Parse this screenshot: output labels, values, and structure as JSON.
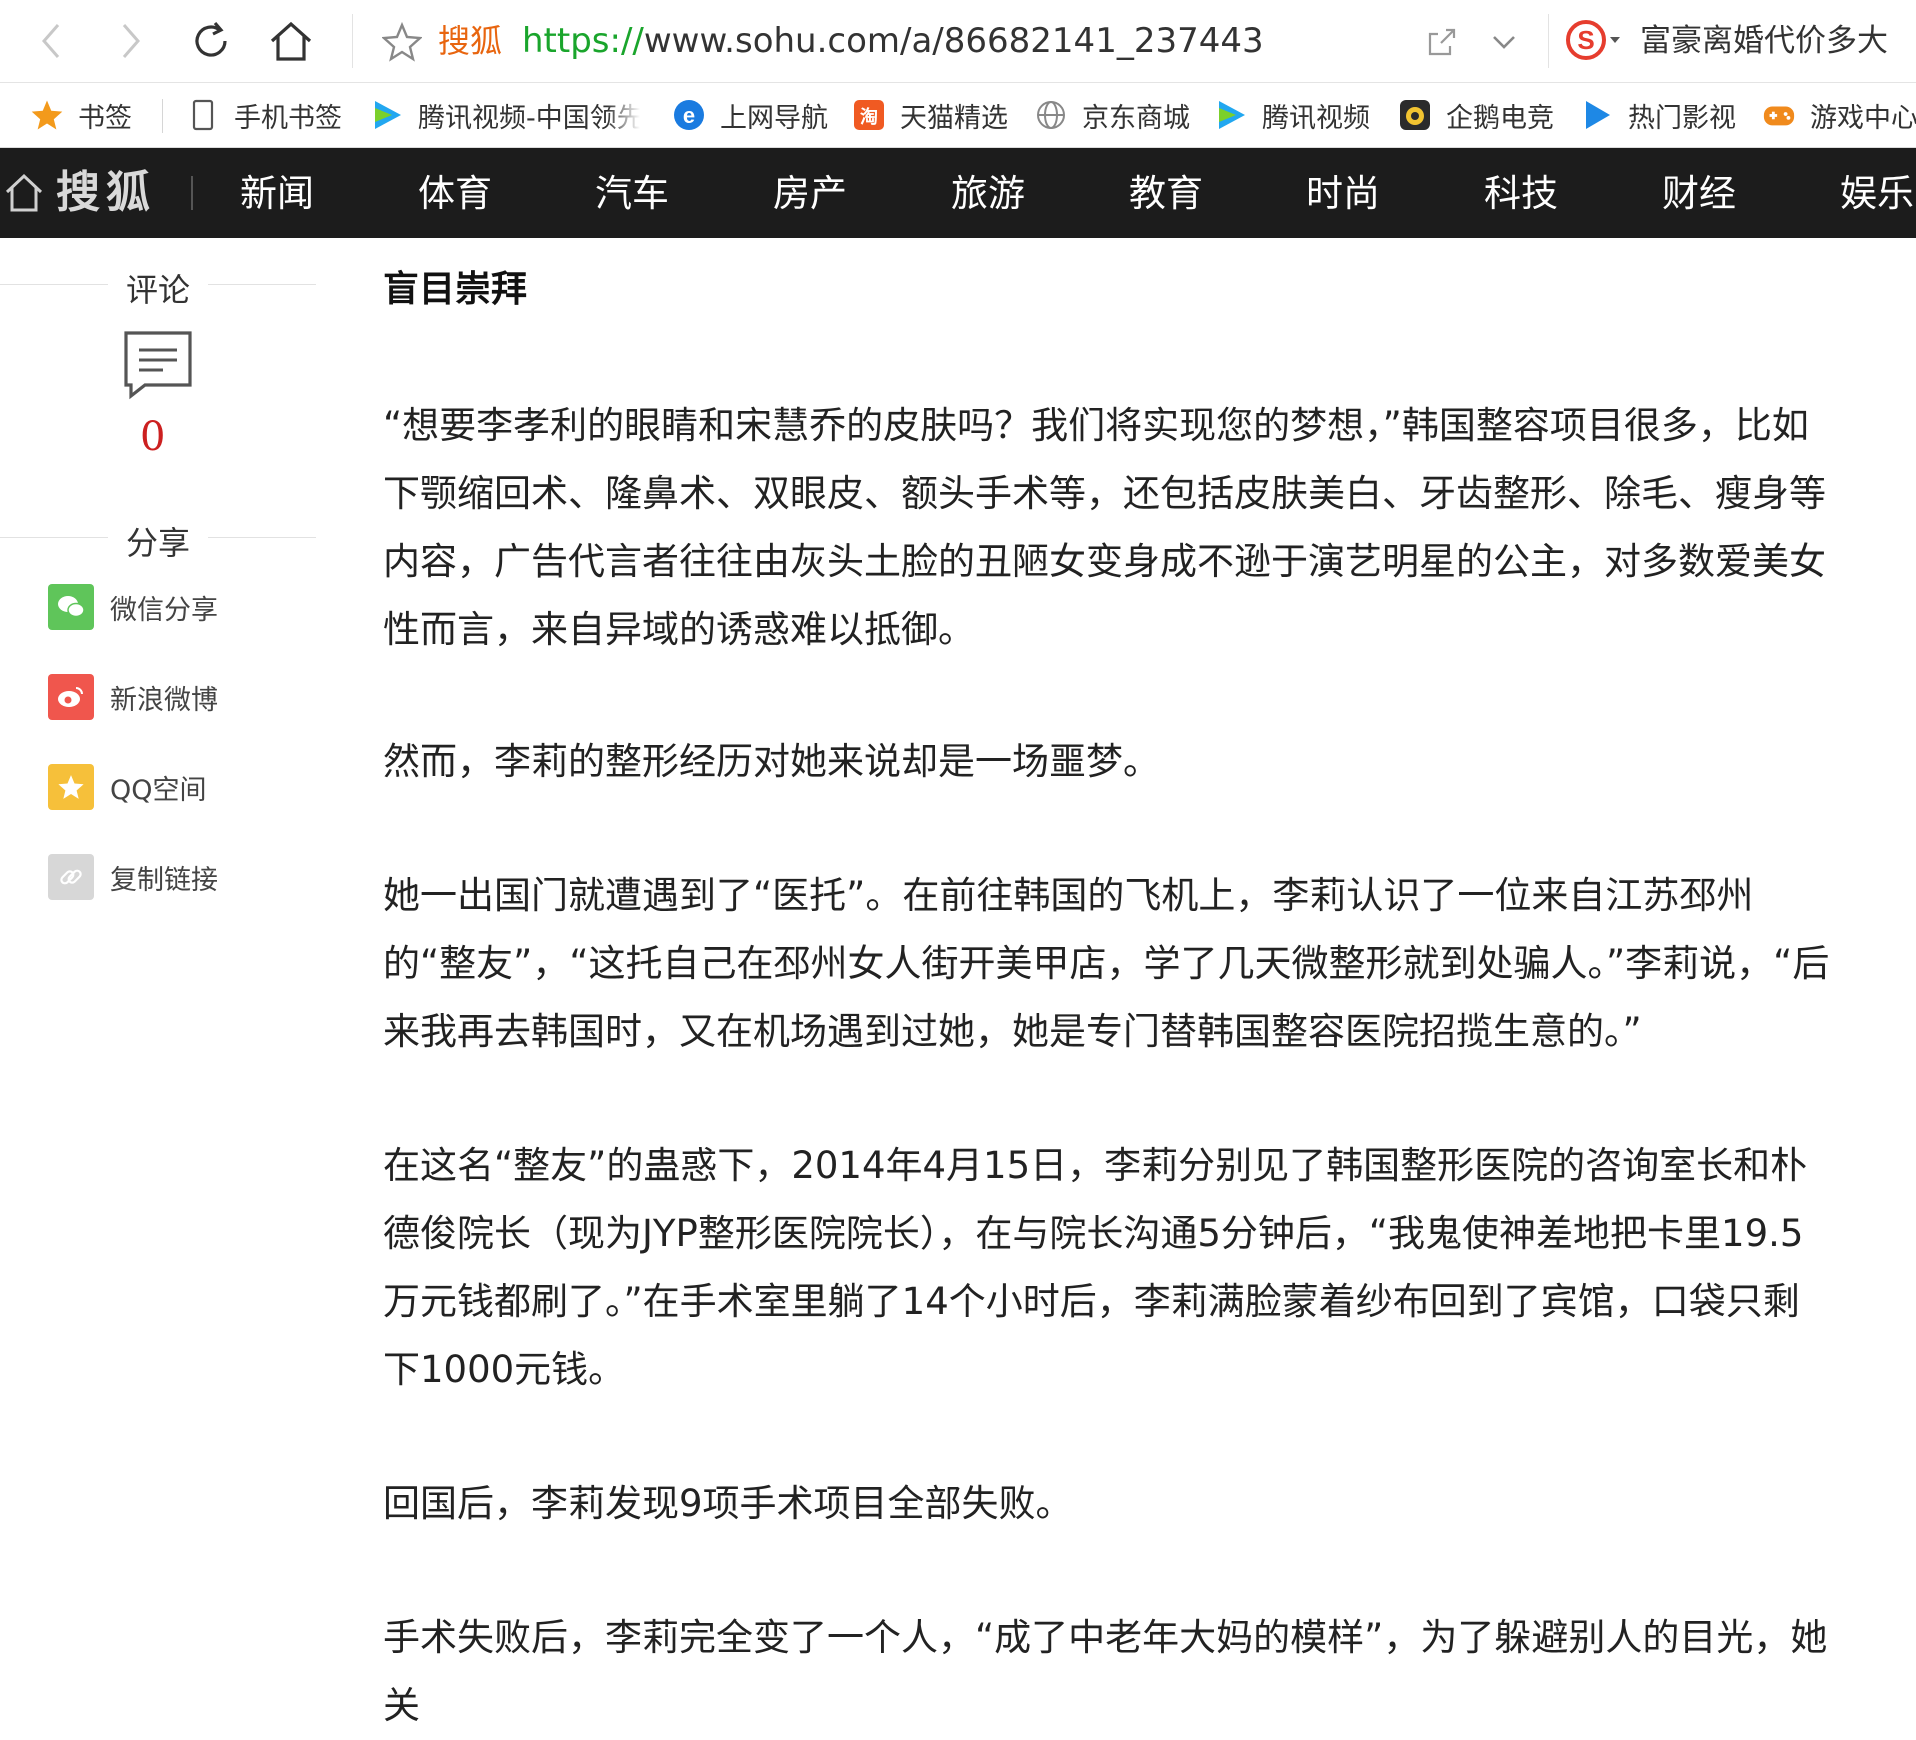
{
  "browser": {
    "address": {
      "site_name": "搜狐",
      "url_scheme": "https://",
      "url_rest": "www.sohu.com/a/86682141_237443"
    },
    "search_box_text": "富豪离婚代价多大",
    "icons": [
      "back-icon",
      "forward-icon",
      "reload-icon",
      "home-icon",
      "star-icon",
      "share-icon",
      "chevron-down-icon",
      "sogou-icon"
    ]
  },
  "bookmarks": [
    {
      "label": "书签",
      "icon": "star-icon"
    },
    {
      "label": "手机书签",
      "icon": "phone-icon"
    },
    {
      "label": "腾讯视频-中国领先",
      "icon": "tencent-video-icon"
    },
    {
      "label": "上网导航",
      "icon": "ie-icon"
    },
    {
      "label": "天猫精选",
      "icon": "tmall-icon"
    },
    {
      "label": "京东商城",
      "icon": "globe-icon"
    },
    {
      "label": "腾讯视频",
      "icon": "tencent-video-icon"
    },
    {
      "label": "企鹅电竞",
      "icon": "penguin-icon"
    },
    {
      "label": "热门影视",
      "icon": "play-icon"
    },
    {
      "label": "游戏中心",
      "icon": "gamepad-icon"
    }
  ],
  "sitenav": {
    "brand": "搜狐",
    "items": [
      "新闻",
      "体育",
      "汽车",
      "房产",
      "旅游",
      "教育",
      "时尚",
      "科技",
      "财经",
      "娱乐"
    ]
  },
  "sidebar": {
    "comment_heading": "评论",
    "comment_count": "0",
    "share_heading": "分享",
    "share_items": [
      {
        "label": "微信分享",
        "color": "#5fc55a"
      },
      {
        "label": "新浪微博",
        "color": "#f0564d"
      },
      {
        "label": "QQ空间",
        "color": "#f6c03a"
      },
      {
        "label": "复制链接",
        "color": "#d7d7d7"
      }
    ]
  },
  "article": {
    "heading": "盲目崇拜",
    "paragraphs": [
      "“想要李孝利的眼睛和宋慧乔的皮肤吗？我们将实现您的梦想，”韩国整容项目很多，比如下颚缩回术、隆鼻术、双眼皮、额头手术等，还包括皮肤美白、牙齿整形、除毛、瘦身等内容，广告代言者往往由灰头土脸的丑陋女变身成不逊于演艺明星的公主，对多数爱美女性而言，来自异域的诱惑难以抵御。",
      "然而，李莉的整形经历对她来说却是一场噩梦。",
      "她一出国门就遭遇到了“医托”。在前往韩国的飞机上，李莉认识了一位来自江苏邳州的“整友”，“这托自己在邳州女人街开美甲店，学了几天微整形就到处骗人。”李莉说，“后来我再去韩国时，又在机场遇到过她，她是专门替韩国整容医院招揽生意的。”",
      "在这名“整友”的蛊惑下，2014年4月15日，李莉分别见了韩国整形医院的咨询室长和朴德俊院长（现为JYP整形医院院长），在与院长沟通5分钟后，“我鬼使神差地把卡里19.5万元钱都刷了。”在手术室里躺了14个小时后，李莉满脸蒙着纱布回到了宾馆，口袋只剩下1000元钱。",
      "回国后，李莉发现9项手术项目全部失败。",
      "手术失败后，李莉完全变了一个人，“成了中老年大妈的模样”，为了躲避别人的目光，她关"
    ]
  },
  "colors": {
    "nav_bg": "#1c1c1c",
    "url_scheme": "#1aa52c",
    "site_name": "#e8650f",
    "comment_count": "#cc2020"
  }
}
